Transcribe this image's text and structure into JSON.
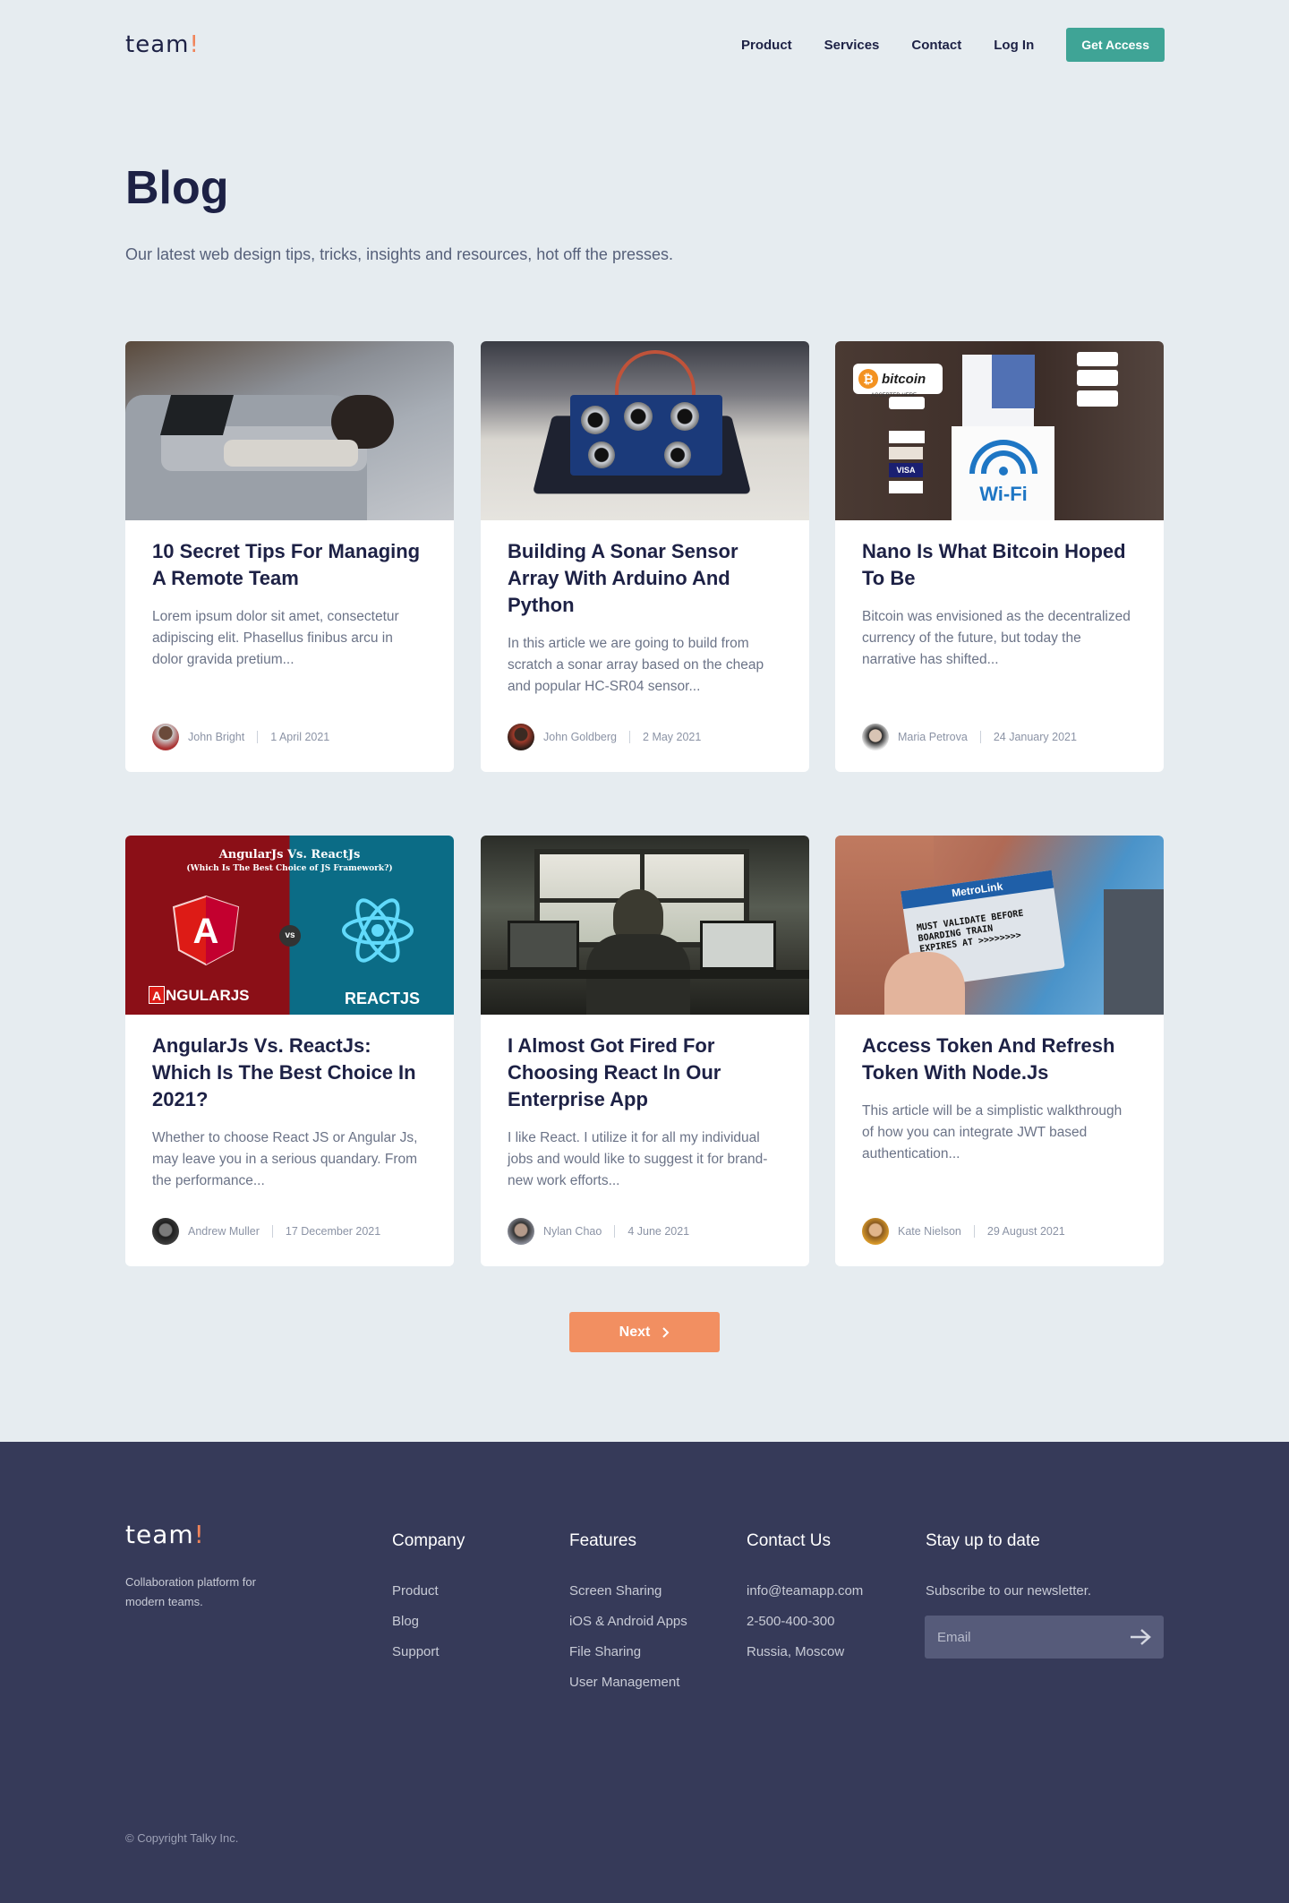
{
  "header": {
    "logo_text": "team",
    "logo_bang": "!",
    "nav": [
      "Product",
      "Services",
      "Contact",
      "Log In"
    ],
    "cta": "Get Access"
  },
  "hero": {
    "title": "Blog",
    "subtitle": "Our latest web design tips, tricks, insights and resources, hot off the presses."
  },
  "posts": [
    {
      "title": "10 Secret Tips For Managing A Remote Team",
      "excerpt": "Lorem ipsum dolor sit amet, consectetur adipiscing elit. Phasellus finibus arcu in dolor gravida pretium...",
      "author": "John Bright",
      "date": "1 April 2021"
    },
    {
      "title": "Building A Sonar Sensor Array With Arduino And Python",
      "excerpt": "In this article we are going to build from scratch a sonar array based on the cheap and popular HC-SR04 sensor...",
      "author": "John Goldberg",
      "date": "2 May 2021"
    },
    {
      "title": "Nano Is What Bitcoin Hoped To Be",
      "excerpt": "Bitcoin was envisioned as the decentralized currency of the future, but today the narrative has shifted...",
      "author": "Maria Petrova",
      "date": "24 January 2021"
    },
    {
      "title": "AngularJs Vs. ReactJs: Which Is The Best Choice In 2021?",
      "excerpt": "Whether to choose React JS or Angular Js, may leave you in a serious quandary. From the performance...",
      "author": "Andrew Muller",
      "date": "17 December 2021"
    },
    {
      "title": "I Almost Got Fired For Choosing React In Our Enterprise App",
      "excerpt": "I like React. I utilize it for all my individual jobs and would like to suggest it for brand-new work efforts...",
      "author": "Nylan Chao",
      "date": "4 June 2021"
    },
    {
      "title": "Access Token And Refresh Token With Node.Js",
      "excerpt": "This article will be a simplistic walkthrough of how you can integrate JWT based authentication...",
      "author": "Kate Nielson",
      "date": "29 August 2021"
    }
  ],
  "image_text": {
    "bitcoin": "bitcoin",
    "bitcoin_sub": "ACCEPTED HERE",
    "wifi": "Wi-Fi",
    "ng_title": "AngularJs Vs. ReactJs",
    "ng_sub": "(Which Is The Best Choice of JS Framework?)",
    "ng_left": "NGULARJS",
    "ng_right": "REACTJS",
    "vs": "vs",
    "metro": "MetroLink",
    "metro_l1": "MUST VALIDATE BEFORE",
    "metro_l2": "BOARDING TRAIN",
    "metro_l3": "EXPIRES AT >>>>>>>>"
  },
  "pagination": {
    "next": "Next"
  },
  "footer": {
    "logo_text": "team",
    "logo_bang": "!",
    "tagline": "Collaboration platform for modern teams.",
    "company": {
      "title": "Company",
      "items": [
        "Product",
        "Blog",
        "Support"
      ]
    },
    "features": {
      "title": "Features",
      "items": [
        "Screen Sharing",
        "iOS & Android Apps",
        "File Sharing",
        "User Management"
      ]
    },
    "contact": {
      "title": "Contact Us",
      "items": [
        "info@teamapp.com",
        "2-500-400-300",
        "Russia, Moscow"
      ]
    },
    "newsletter": {
      "title": "Stay up to date",
      "text": "Subscribe to our newsletter.",
      "placeholder": "Email"
    },
    "copyright": "© Copyright Talky Inc."
  },
  "colors": {
    "accent": "#3fa496",
    "orange": "#f28f61",
    "navy": "#1d2145",
    "footer": "#363a59",
    "bg": "#e6ecf0"
  }
}
